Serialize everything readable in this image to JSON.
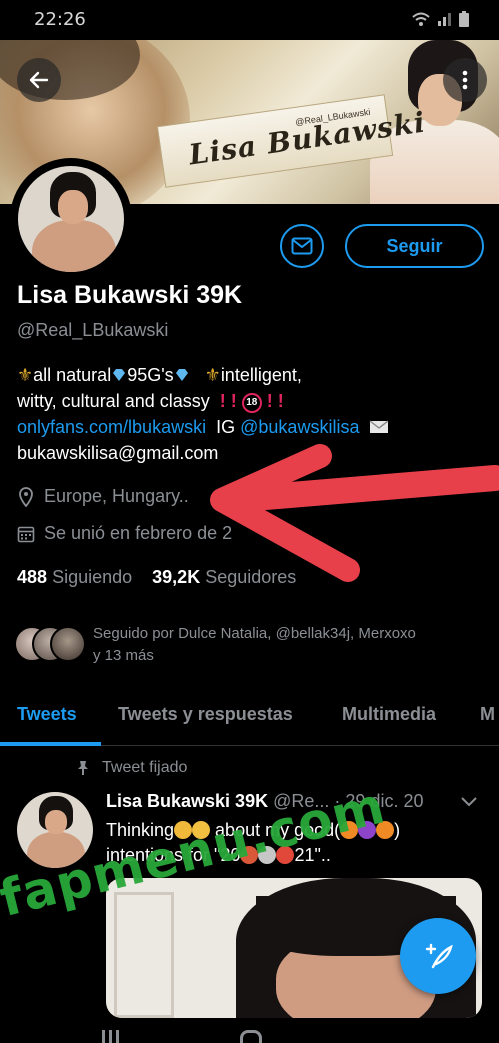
{
  "status_bar": {
    "time": "22:26"
  },
  "banner": {
    "name": "Lisa Bukawski",
    "handle": "@Real_LBukawski"
  },
  "header": {
    "back_icon": "arrow-left-icon",
    "more_icon": "more-vertical-icon"
  },
  "profile": {
    "display_name": "Lisa Bukawski 39K",
    "handle": "@Real_LBukawski",
    "follow_label": "Seguir",
    "bio": {
      "part1": "all natural",
      "part2": "95G's",
      "part3": "intelligent,",
      "line2": "witty, cultural and classy",
      "line2_mark": "! !",
      "badge": "18",
      "line2_mark2": "! !",
      "link": "onlyfans.com/lbukawski",
      "ig_label": "IG",
      "ig_handle": "@bukawskilisa",
      "email": "bukawskilisa@gmail.com"
    },
    "location": "Europe, Hungary..",
    "joined": "Se unió en febrero de 2",
    "following_count": "488",
    "following_label": "Siguiendo",
    "followers_count": "39,2K",
    "followers_label": "Seguidores",
    "followed_by_line1": "Seguido por Dulce Natalia, @bellak34j, Merxoxo",
    "followed_by_line2": "y 13 más"
  },
  "tabs": [
    {
      "label": "Tweets"
    },
    {
      "label": "Tweets y respuestas"
    },
    {
      "label": "Multimedia"
    },
    {
      "label": "M"
    }
  ],
  "tweet": {
    "pinned_label": "Tweet fijado",
    "author": "Lisa Bukawski 39K",
    "handle": "@Re...",
    "date": "· 29 dic. 20",
    "text_a": "Thinking",
    "text_b": " about my good(",
    "text_c": ")",
    "text_line2_a": "intentions for \"20",
    "text_line2_b": "21\".."
  },
  "watermark": "fapmenu.com",
  "colors": {
    "accent": "#1d9bf0",
    "muted": "#8b8f94",
    "alert_red": "#e0245e",
    "annotation": "#e8404a",
    "watermark": "#2aa83a"
  }
}
